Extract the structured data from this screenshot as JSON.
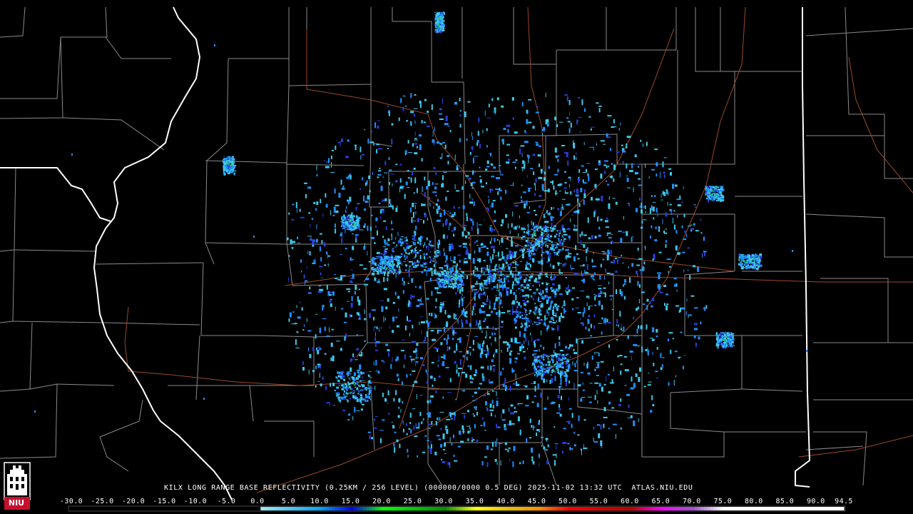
{
  "product_title": "KILX LONG RANGE BASE REFLECTIVITY (0.25KM / 256 LEVEL) (000000/0000 0.5 DEG) 2025-11-02 13:32 UTC  ATLAS.NIU.EDU",
  "logo": {
    "text": "NIU",
    "icon": "niu-castle-logo-icon",
    "color": "#c8102e"
  },
  "colorbar": {
    "ticks": [
      "-30.0",
      "-25.0",
      "-20.0",
      "-15.0",
      "-10.0",
      "-5.0",
      "0.0",
      "5.0",
      "10.0",
      "15.0",
      "20.0",
      "25.0",
      "30.0",
      "35.0",
      "40.0",
      "45.0",
      "50.0",
      "55.0",
      "60.0",
      "65.0",
      "70.0",
      "75.0",
      "80.0",
      "85.0",
      "90.0",
      "94.5"
    ],
    "stops": [
      {
        "dbz": -30,
        "color": "#000000"
      },
      {
        "dbz": 0,
        "color": "#000000"
      },
      {
        "dbz": 0.5,
        "color": "#9ce6f0"
      },
      {
        "dbz": 10,
        "color": "#01a0f6"
      },
      {
        "dbz": 15,
        "color": "#0000f6"
      },
      {
        "dbz": 20,
        "color": "#00ff00"
      },
      {
        "dbz": 25,
        "color": "#00c800"
      },
      {
        "dbz": 30,
        "color": "#009000"
      },
      {
        "dbz": 35,
        "color": "#ffff00"
      },
      {
        "dbz": 40,
        "color": "#e7c000"
      },
      {
        "dbz": 45,
        "color": "#ff9000"
      },
      {
        "dbz": 50,
        "color": "#ff0000"
      },
      {
        "dbz": 55,
        "color": "#d60000"
      },
      {
        "dbz": 60,
        "color": "#c00000"
      },
      {
        "dbz": 65,
        "color": "#ff00ff"
      },
      {
        "dbz": 70,
        "color": "#9955c9"
      },
      {
        "dbz": 75,
        "color": "#ffffff"
      },
      {
        "dbz": 94.5,
        "color": "#ffffff"
      }
    ]
  },
  "colors": {
    "background": "#000000",
    "state_borders": "#ffffff",
    "county_lines": "#9a9a9a",
    "highways": "#a0522d",
    "echo_light": "#3ec9e8",
    "echo_mid": "#1e90ff",
    "echo_dark": "#2a3cd8",
    "echo_green": "#22c55e"
  }
}
